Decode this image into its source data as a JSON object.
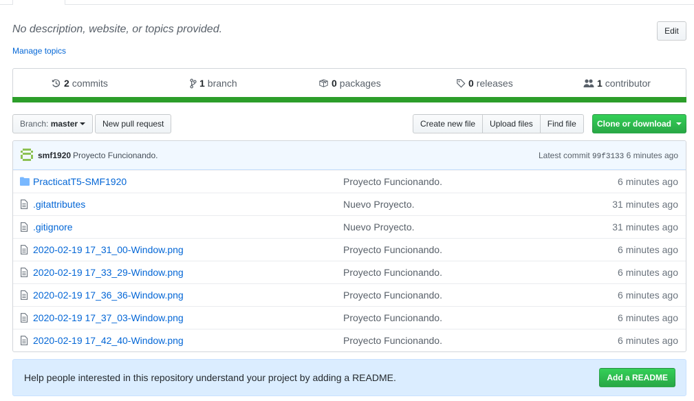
{
  "repo": {
    "description": "No description, website, or topics provided.",
    "manage_topics": "Manage topics",
    "edit_label": "Edit"
  },
  "stats": {
    "commits_count": "2",
    "commits_label": "commits",
    "branch_count": "1",
    "branch_label": "branch",
    "packages_count": "0",
    "packages_label": "packages",
    "releases_count": "0",
    "releases_label": "releases",
    "contributors_count": "1",
    "contributors_label": "contributor",
    "bar_color": "#2c9e2a"
  },
  "toolbar": {
    "branch_prefix": "Branch:",
    "branch_name": "master",
    "new_pull_request": "New pull request",
    "create_new_file": "Create new file",
    "upload_files": "Upload files",
    "find_file": "Find file",
    "clone_or_download": "Clone or download"
  },
  "latest_commit": {
    "author": "smf1920",
    "message": "Proyecto Funcionando.",
    "prefix": "Latest commit",
    "sha": "99f3133",
    "age": "6 minutes ago"
  },
  "files": [
    {
      "icon": "folder-icon",
      "name": "PracticatT5-SMF1920",
      "message": "Proyecto Funcionando.",
      "age": "6 minutes ago"
    },
    {
      "icon": "file-icon",
      "name": ".gitattributes",
      "message": "Nuevo Proyecto.",
      "age": "31 minutes ago"
    },
    {
      "icon": "file-icon",
      "name": ".gitignore",
      "message": "Nuevo Proyecto.",
      "age": "31 minutes ago"
    },
    {
      "icon": "file-icon",
      "name": "2020-02-19 17_31_00-Window.png",
      "message": "Proyecto Funcionando.",
      "age": "6 minutes ago"
    },
    {
      "icon": "file-icon",
      "name": "2020-02-19 17_33_29-Window.png",
      "message": "Proyecto Funcionando.",
      "age": "6 minutes ago"
    },
    {
      "icon": "file-icon",
      "name": "2020-02-19 17_36_36-Window.png",
      "message": "Proyecto Funcionando.",
      "age": "6 minutes ago"
    },
    {
      "icon": "file-icon",
      "name": "2020-02-19 17_37_03-Window.png",
      "message": "Proyecto Funcionando.",
      "age": "6 minutes ago"
    },
    {
      "icon": "file-icon",
      "name": "2020-02-19 17_42_40-Window.png",
      "message": "Proyecto Funcionando.",
      "age": "6 minutes ago"
    }
  ],
  "readme": {
    "prompt": "Help people interested in this repository understand your project by adding a README.",
    "button": "Add a README"
  },
  "colors": {
    "link": "#0366d6",
    "primary_green": "#28a745",
    "readme_bg": "#dbedff"
  }
}
